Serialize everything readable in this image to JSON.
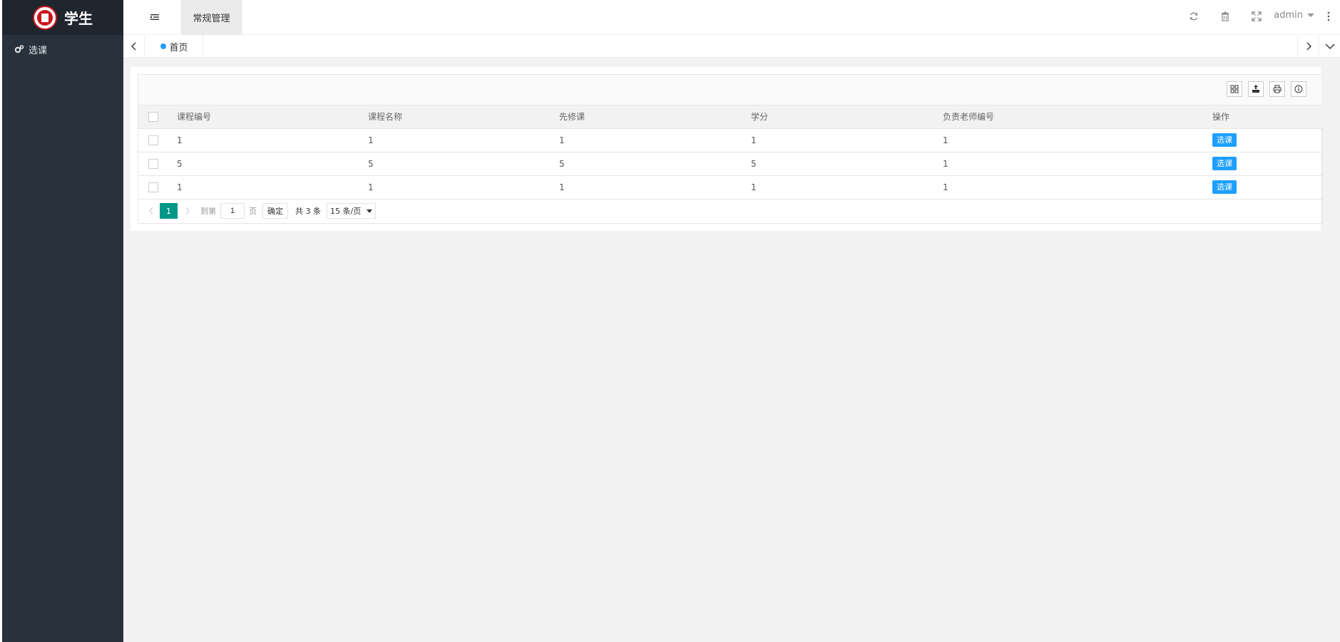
{
  "sidebar": {
    "logo_text": "学生",
    "items": [
      {
        "label": "选课",
        "icon": "gears-icon"
      }
    ]
  },
  "header": {
    "top_tab": "常规管理",
    "user": "admin",
    "icons": [
      "menu-toggle-icon",
      "refresh-icon",
      "trash-icon",
      "fullscreen-icon",
      "more-vertical-icon"
    ]
  },
  "tabstrip": {
    "home_tab": "首页"
  },
  "table": {
    "columns": [
      "课程编号",
      "课程名称",
      "先修课",
      "学分",
      "负责老师编号",
      "操作"
    ],
    "rows": [
      {
        "course_id": "1",
        "course_name": "1",
        "prerequisite": "1",
        "credits": "1",
        "teacher_id": "1",
        "action": "选课"
      },
      {
        "course_id": "5",
        "course_name": "5",
        "prerequisite": "5",
        "credits": "5",
        "teacher_id": "1",
        "action": "选课"
      },
      {
        "course_id": "1",
        "course_name": "1",
        "prerequisite": "1",
        "credits": "1",
        "teacher_id": "1",
        "action": "选课"
      }
    ],
    "toolbar_icons": [
      "columns-icon",
      "export-icon",
      "print-icon",
      "info-icon"
    ]
  },
  "pager": {
    "current_page": "1",
    "goto_prefix": "到第",
    "goto_value": "1",
    "goto_suffix": "页",
    "confirm": "确定",
    "total": "共 3 条",
    "page_size": "15 条/页"
  },
  "colors": {
    "sidebar_bg": "#28323d",
    "logo_bg": "#20262e",
    "primary_button": "#1e9fff",
    "active_page": "#009688",
    "content_bg": "#f2f2f2"
  }
}
